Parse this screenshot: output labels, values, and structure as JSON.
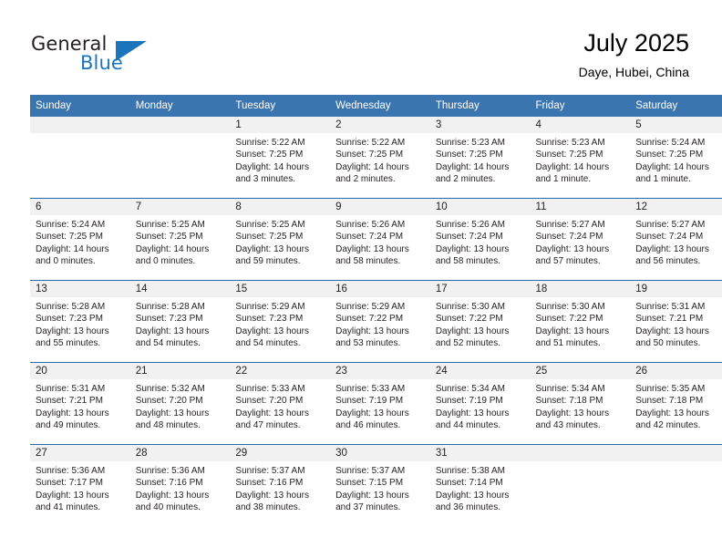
{
  "brand": {
    "name_top": "General",
    "name_bottom": "Blue",
    "accent_color": "#1b75bb"
  },
  "header": {
    "title": "July 2025",
    "subtitle": "Daye, Hubei, China",
    "header_bg": "#3a75b0",
    "row_divider": "#2b6cab",
    "daynum_bg": "#f1f1f1"
  },
  "weekday_headers": [
    "Sunday",
    "Monday",
    "Tuesday",
    "Wednesday",
    "Thursday",
    "Friday",
    "Saturday"
  ],
  "weeks": [
    [
      {
        "day": "",
        "sunrise": "",
        "sunset": "",
        "daylight1": "",
        "daylight2": "",
        "empty": true
      },
      {
        "day": "",
        "sunrise": "",
        "sunset": "",
        "daylight1": "",
        "daylight2": "",
        "empty": true
      },
      {
        "day": "1",
        "sunrise": "Sunrise: 5:22 AM",
        "sunset": "Sunset: 7:25 PM",
        "daylight1": "Daylight: 14 hours",
        "daylight2": "and 3 minutes."
      },
      {
        "day": "2",
        "sunrise": "Sunrise: 5:22 AM",
        "sunset": "Sunset: 7:25 PM",
        "daylight1": "Daylight: 14 hours",
        "daylight2": "and 2 minutes."
      },
      {
        "day": "3",
        "sunrise": "Sunrise: 5:23 AM",
        "sunset": "Sunset: 7:25 PM",
        "daylight1": "Daylight: 14 hours",
        "daylight2": "and 2 minutes."
      },
      {
        "day": "4",
        "sunrise": "Sunrise: 5:23 AM",
        "sunset": "Sunset: 7:25 PM",
        "daylight1": "Daylight: 14 hours",
        "daylight2": "and 1 minute."
      },
      {
        "day": "5",
        "sunrise": "Sunrise: 5:24 AM",
        "sunset": "Sunset: 7:25 PM",
        "daylight1": "Daylight: 14 hours",
        "daylight2": "and 1 minute."
      }
    ],
    [
      {
        "day": "6",
        "sunrise": "Sunrise: 5:24 AM",
        "sunset": "Sunset: 7:25 PM",
        "daylight1": "Daylight: 14 hours",
        "daylight2": "and 0 minutes."
      },
      {
        "day": "7",
        "sunrise": "Sunrise: 5:25 AM",
        "sunset": "Sunset: 7:25 PM",
        "daylight1": "Daylight: 14 hours",
        "daylight2": "and 0 minutes."
      },
      {
        "day": "8",
        "sunrise": "Sunrise: 5:25 AM",
        "sunset": "Sunset: 7:25 PM",
        "daylight1": "Daylight: 13 hours",
        "daylight2": "and 59 minutes."
      },
      {
        "day": "9",
        "sunrise": "Sunrise: 5:26 AM",
        "sunset": "Sunset: 7:24 PM",
        "daylight1": "Daylight: 13 hours",
        "daylight2": "and 58 minutes."
      },
      {
        "day": "10",
        "sunrise": "Sunrise: 5:26 AM",
        "sunset": "Sunset: 7:24 PM",
        "daylight1": "Daylight: 13 hours",
        "daylight2": "and 58 minutes."
      },
      {
        "day": "11",
        "sunrise": "Sunrise: 5:27 AM",
        "sunset": "Sunset: 7:24 PM",
        "daylight1": "Daylight: 13 hours",
        "daylight2": "and 57 minutes."
      },
      {
        "day": "12",
        "sunrise": "Sunrise: 5:27 AM",
        "sunset": "Sunset: 7:24 PM",
        "daylight1": "Daylight: 13 hours",
        "daylight2": "and 56 minutes."
      }
    ],
    [
      {
        "day": "13",
        "sunrise": "Sunrise: 5:28 AM",
        "sunset": "Sunset: 7:23 PM",
        "daylight1": "Daylight: 13 hours",
        "daylight2": "and 55 minutes."
      },
      {
        "day": "14",
        "sunrise": "Sunrise: 5:28 AM",
        "sunset": "Sunset: 7:23 PM",
        "daylight1": "Daylight: 13 hours",
        "daylight2": "and 54 minutes."
      },
      {
        "day": "15",
        "sunrise": "Sunrise: 5:29 AM",
        "sunset": "Sunset: 7:23 PM",
        "daylight1": "Daylight: 13 hours",
        "daylight2": "and 54 minutes."
      },
      {
        "day": "16",
        "sunrise": "Sunrise: 5:29 AM",
        "sunset": "Sunset: 7:22 PM",
        "daylight1": "Daylight: 13 hours",
        "daylight2": "and 53 minutes."
      },
      {
        "day": "17",
        "sunrise": "Sunrise: 5:30 AM",
        "sunset": "Sunset: 7:22 PM",
        "daylight1": "Daylight: 13 hours",
        "daylight2": "and 52 minutes."
      },
      {
        "day": "18",
        "sunrise": "Sunrise: 5:30 AM",
        "sunset": "Sunset: 7:22 PM",
        "daylight1": "Daylight: 13 hours",
        "daylight2": "and 51 minutes."
      },
      {
        "day": "19",
        "sunrise": "Sunrise: 5:31 AM",
        "sunset": "Sunset: 7:21 PM",
        "daylight1": "Daylight: 13 hours",
        "daylight2": "and 50 minutes."
      }
    ],
    [
      {
        "day": "20",
        "sunrise": "Sunrise: 5:31 AM",
        "sunset": "Sunset: 7:21 PM",
        "daylight1": "Daylight: 13 hours",
        "daylight2": "and 49 minutes."
      },
      {
        "day": "21",
        "sunrise": "Sunrise: 5:32 AM",
        "sunset": "Sunset: 7:20 PM",
        "daylight1": "Daylight: 13 hours",
        "daylight2": "and 48 minutes."
      },
      {
        "day": "22",
        "sunrise": "Sunrise: 5:33 AM",
        "sunset": "Sunset: 7:20 PM",
        "daylight1": "Daylight: 13 hours",
        "daylight2": "and 47 minutes."
      },
      {
        "day": "23",
        "sunrise": "Sunrise: 5:33 AM",
        "sunset": "Sunset: 7:19 PM",
        "daylight1": "Daylight: 13 hours",
        "daylight2": "and 46 minutes."
      },
      {
        "day": "24",
        "sunrise": "Sunrise: 5:34 AM",
        "sunset": "Sunset: 7:19 PM",
        "daylight1": "Daylight: 13 hours",
        "daylight2": "and 44 minutes."
      },
      {
        "day": "25",
        "sunrise": "Sunrise: 5:34 AM",
        "sunset": "Sunset: 7:18 PM",
        "daylight1": "Daylight: 13 hours",
        "daylight2": "and 43 minutes."
      },
      {
        "day": "26",
        "sunrise": "Sunrise: 5:35 AM",
        "sunset": "Sunset: 7:18 PM",
        "daylight1": "Daylight: 13 hours",
        "daylight2": "and 42 minutes."
      }
    ],
    [
      {
        "day": "27",
        "sunrise": "Sunrise: 5:36 AM",
        "sunset": "Sunset: 7:17 PM",
        "daylight1": "Daylight: 13 hours",
        "daylight2": "and 41 minutes."
      },
      {
        "day": "28",
        "sunrise": "Sunrise: 5:36 AM",
        "sunset": "Sunset: 7:16 PM",
        "daylight1": "Daylight: 13 hours",
        "daylight2": "and 40 minutes."
      },
      {
        "day": "29",
        "sunrise": "Sunrise: 5:37 AM",
        "sunset": "Sunset: 7:16 PM",
        "daylight1": "Daylight: 13 hours",
        "daylight2": "and 38 minutes."
      },
      {
        "day": "30",
        "sunrise": "Sunrise: 5:37 AM",
        "sunset": "Sunset: 7:15 PM",
        "daylight1": "Daylight: 13 hours",
        "daylight2": "and 37 minutes."
      },
      {
        "day": "31",
        "sunrise": "Sunrise: 5:38 AM",
        "sunset": "Sunset: 7:14 PM",
        "daylight1": "Daylight: 13 hours",
        "daylight2": "and 36 minutes."
      },
      {
        "day": "",
        "sunrise": "",
        "sunset": "",
        "daylight1": "",
        "daylight2": "",
        "empty": true
      },
      {
        "day": "",
        "sunrise": "",
        "sunset": "",
        "daylight1": "",
        "daylight2": "",
        "empty": true
      }
    ]
  ]
}
